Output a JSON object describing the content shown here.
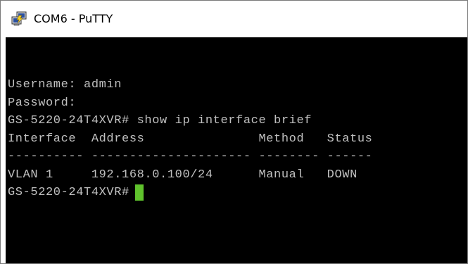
{
  "window": {
    "title": "COM6 - PuTTY",
    "icon": "putty-icon"
  },
  "terminal": {
    "lines": [
      "Username: admin",
      "Password:",
      "GS-5220-24T4XVR# show ip interface brief",
      "Interface  Address               Method   Status",
      "---------- --------------------- -------- ------",
      "VLAN 1     192.168.0.100/24      Manual   DOWN"
    ],
    "prompt": "GS-5220-24T4XVR#",
    "foreground_color": "#c0c0c0",
    "background_color": "#000000",
    "cursor_color": "#5fc22c"
  }
}
